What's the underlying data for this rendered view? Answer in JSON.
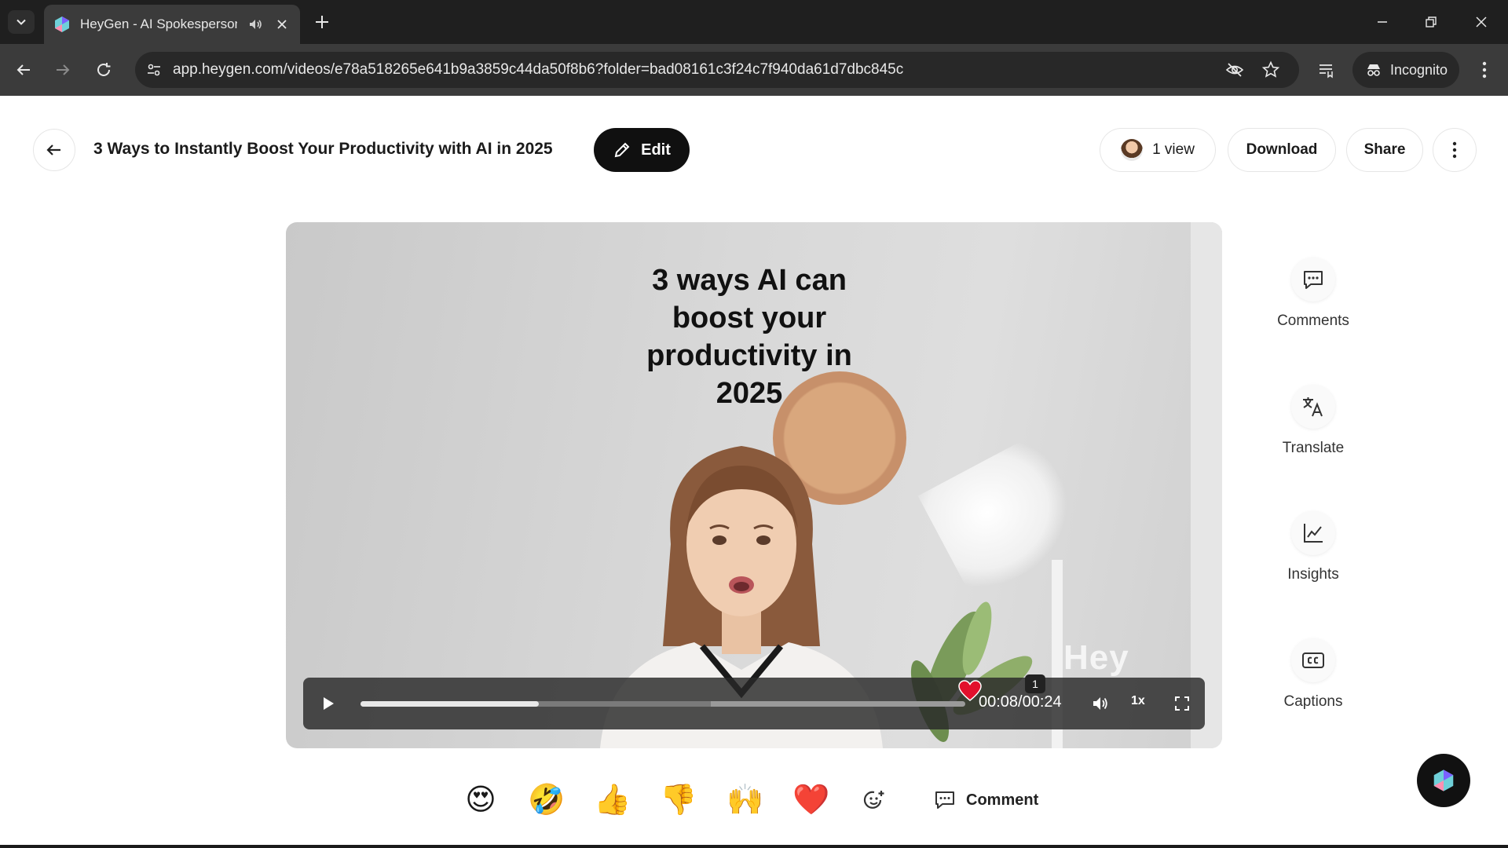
{
  "browser": {
    "tab_title": "HeyGen - AI Spokesperson",
    "url": "app.heygen.com/videos/e78a518265e641b9a3859c44da50f8b6?folder=bad08161c3f24c7f940da61d7dbc845c",
    "incognito_label": "Incognito"
  },
  "header": {
    "title": "3 Ways to Instantly Boost Your Productivity with AI in 2025",
    "edit_label": "Edit",
    "views_label": "1 view",
    "download_label": "Download",
    "share_label": "Share"
  },
  "video": {
    "caption": "3 ways AI can boost your productivity in 2025",
    "watermark": "Hey",
    "time": "00:08/00:24",
    "speed": "1x",
    "comment_marker_count": "1",
    "progress_fraction": 0.295,
    "accent_heart_color": "#e2102c"
  },
  "side_panel": {
    "comments_label": "Comments",
    "translate_label": "Translate",
    "insights_label": "Insights",
    "captions_label": "Captions"
  },
  "reactions": {
    "items": [
      "😍",
      "🤣",
      "👍",
      "👎",
      "🙌",
      "❤️",
      "sticker-add-icon"
    ],
    "comment_label": "Comment"
  }
}
